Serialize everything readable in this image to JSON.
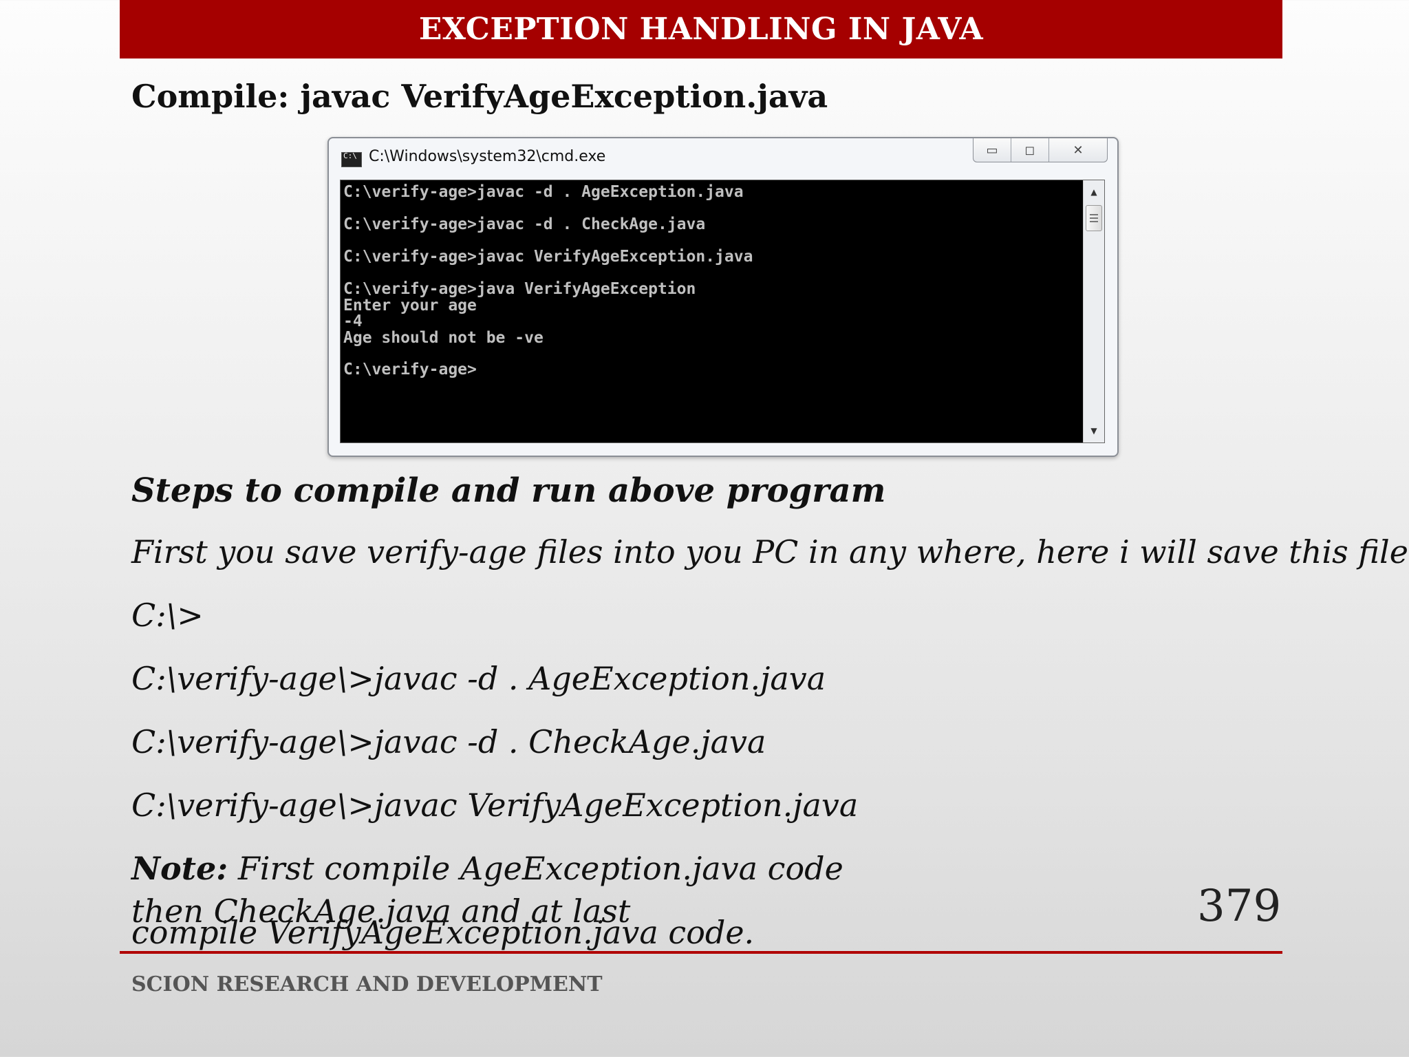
{
  "slide": {
    "title": "EXCEPTION HANDLING IN JAVA",
    "compile_line": "Compile: javac VerifyAgeException.java",
    "page_number": "379",
    "footer": "SCION RESEARCH AND DEVELOPMENT"
  },
  "console_window": {
    "title": "C:\\Windows\\system32\\cmd.exe",
    "icon_label": "C:\\",
    "controls": {
      "minimize": "▭",
      "maximize": "◻",
      "close": "✕"
    },
    "lines": [
      "C:\\verify-age>javac -d . AgeException.java",
      "",
      "C:\\verify-age>javac -d . CheckAge.java",
      "",
      "C:\\verify-age>javac VerifyAgeException.java",
      "",
      "C:\\verify-age>java VerifyAgeException",
      "Enter your age",
      "-4",
      "Age should not be -ve",
      "",
      "C:\\verify-age>"
    ],
    "scroll": {
      "up": "▲",
      "down": "▼"
    }
  },
  "steps": {
    "heading": "Steps to compile and run above program",
    "intro": "First you save verify-age files into you PC in any where, here i will save this  file in",
    "lines": [
      "C:\\>",
      "C:\\verify-age\\>javac -d . AgeException.java",
      "C:\\verify-age\\>javac -d . CheckAge.java",
      "C:\\verify-age\\>javac VerifyAgeException.java"
    ],
    "note_label": "Note:",
    "note_text_1": " First compile AgeException.java code",
    "note_text_2": "then CheckAge.java and at  last",
    "note_text_3": "compile VerifyAgeException.java code."
  }
}
